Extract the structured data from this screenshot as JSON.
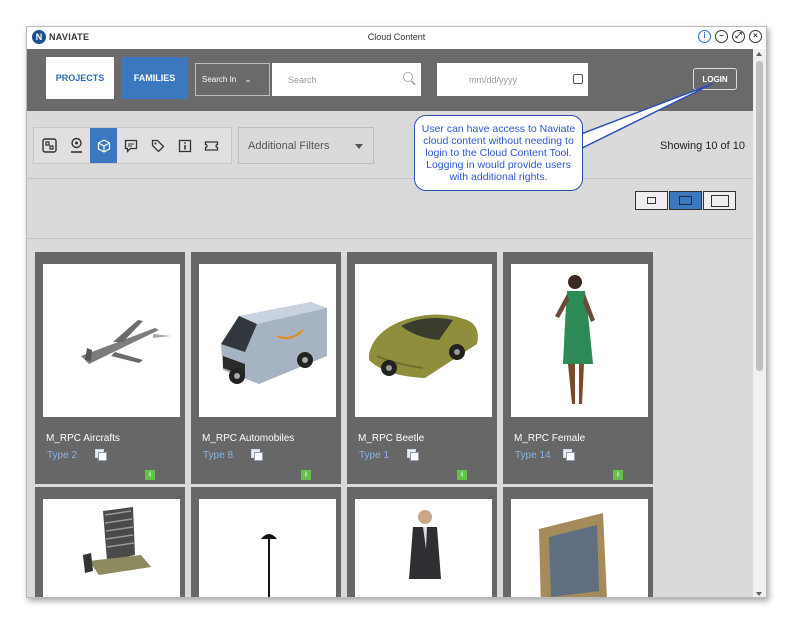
{
  "window": {
    "title": "Cloud Content",
    "logo_letter": "N",
    "logo_text": "NAVIATE"
  },
  "topbar": {
    "projects_label": "PROJECTS",
    "families_label": "FAMILIES",
    "search_in_label": "Search In",
    "search_placeholder": "Search",
    "date_placeholder": "mm/dd/yyyy",
    "login_label": "LOGIN"
  },
  "toolbar": {
    "filters_label": "Additional Filters",
    "showing_text": "Showing 10 of 10"
  },
  "callout": {
    "text": "User can have access to Naviate cloud content without needing to login to the Cloud Content Tool. Logging in would provide users with additional rights."
  },
  "cards": [
    {
      "name": "M_RPC Aircrafts",
      "type": "Type 2"
    },
    {
      "name": "M_RPC Automobiles",
      "type": "Type 8"
    },
    {
      "name": "M_RPC Beetle",
      "type": "Type 1"
    },
    {
      "name": "M_RPC Female",
      "type": "Type 14"
    }
  ],
  "colors": {
    "accent": "#3b78bd",
    "topbar": "#6a6a6a",
    "content_bg": "#d9dad9",
    "card_bg": "#676767",
    "download": "#64c14b"
  },
  "icons": {
    "toolbar": [
      "floorplan-icon",
      "location-pin-icon",
      "cube-icon",
      "comment-icon",
      "tag-icon",
      "info-icon",
      "ticket-icon"
    ],
    "window_controls": [
      "info-icon",
      "minimize-icon",
      "restore-icon",
      "close-icon"
    ]
  }
}
